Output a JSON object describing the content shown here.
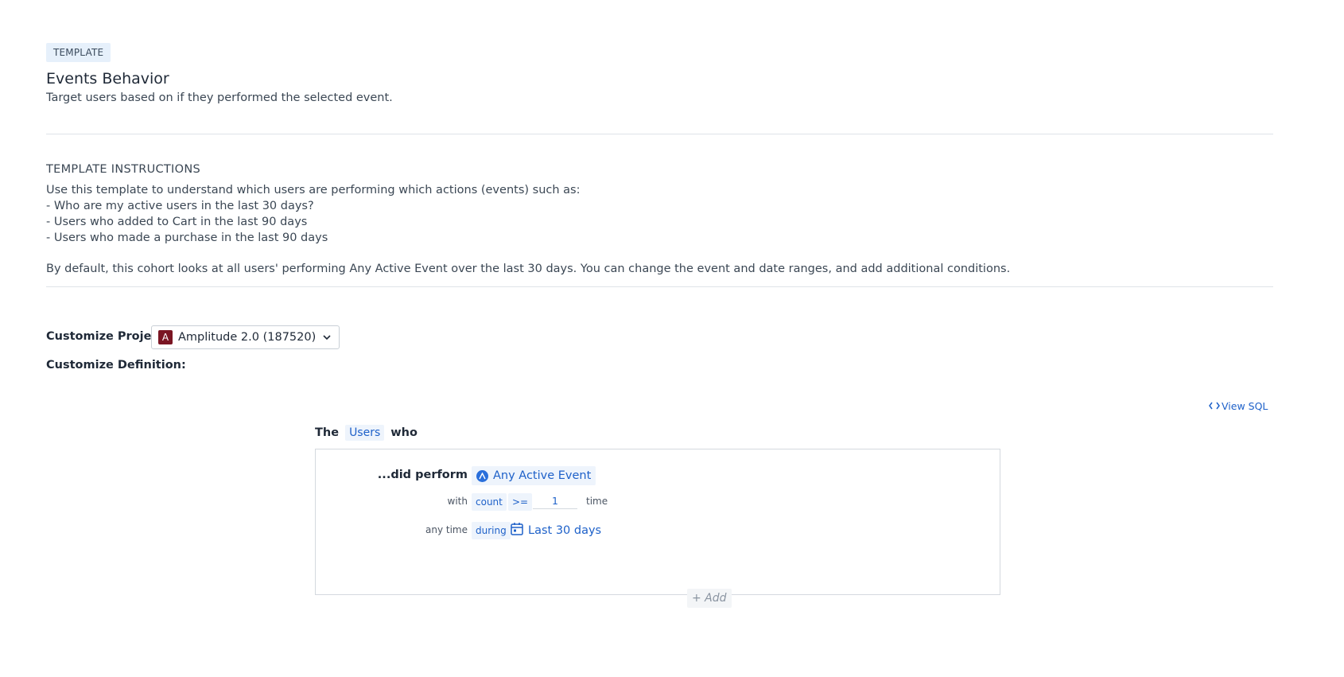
{
  "header": {
    "tag": "TEMPLATE",
    "title": "Events Behavior",
    "subtitle": "Target users based on if they performed the selected event."
  },
  "instructions": {
    "heading": "TEMPLATE INSTRUCTIONS",
    "lines": [
      "Use this template to understand which users are performing which actions (events) such as:",
      "- Who are my active users in the last 30 days?",
      "- Users who added to Cart in the last 90 days",
      "- Users who made a purchase in the last 90 days"
    ],
    "default_text": "By default, this cohort looks at all users' performing Any Active Event over the last 30 days. You can change the event and date ranges, and add additional conditions."
  },
  "customize": {
    "project_label": "Customize Project:",
    "project_badge": "A",
    "project_value": "Amplitude 2.0 (187520)",
    "definition_label": "Customize Definition:"
  },
  "definition": {
    "view_sql": "View SQL",
    "the": "The",
    "entity": "Users",
    "who": "who",
    "did_perform": "...did perform",
    "event": "Any Active Event",
    "with_label": "with",
    "metric": "count",
    "operator": ">=",
    "count_value": "1",
    "time_label": "time",
    "any_time_label": "any time",
    "during_label": "during",
    "date_range": "Last 30 days",
    "add_label": "+ Add"
  },
  "colors": {
    "accent": "#1e61c9",
    "chip_bg": "#eef4fc",
    "project_badge": "#7a1523"
  }
}
